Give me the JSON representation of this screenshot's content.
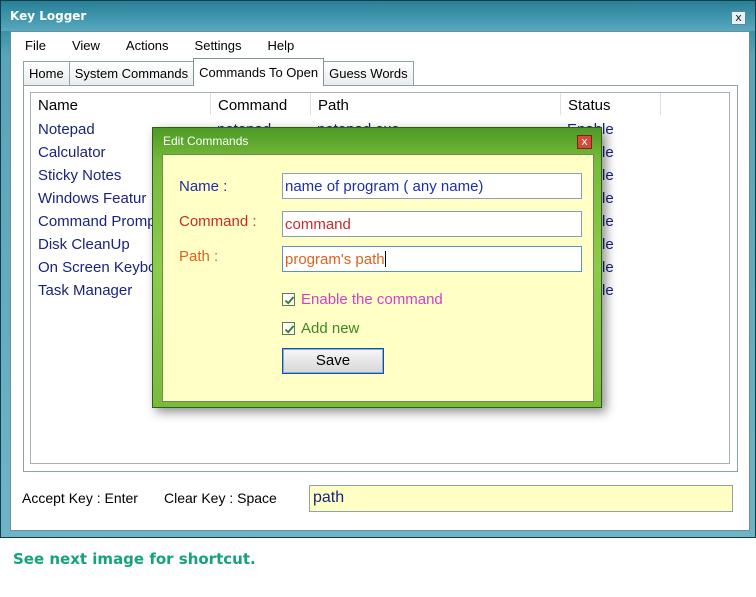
{
  "window": {
    "title": "Key Logger",
    "close_glyph": "x"
  },
  "menu": [
    {
      "label": "File"
    },
    {
      "label": "View"
    },
    {
      "label": "Actions"
    },
    {
      "label": "Settings"
    },
    {
      "label": "Help"
    }
  ],
  "tabs": [
    {
      "label": "Home",
      "active": false
    },
    {
      "label": "System Commands",
      "active": false
    },
    {
      "label": "Commands To Open",
      "active": true
    },
    {
      "label": "Guess Words",
      "active": false
    }
  ],
  "list": {
    "columns": [
      "Name",
      "Command",
      "Path",
      "Status"
    ],
    "rows": [
      {
        "name": "Notepad",
        "command": "notepad",
        "path": "notepad.exe",
        "status": "Enable"
      },
      {
        "name": "Calculator",
        "status": "Enable"
      },
      {
        "name": "Sticky Notes",
        "status": "Enable"
      },
      {
        "name": "Windows Featur",
        "status": "Enable"
      },
      {
        "name": "Command Promp",
        "status": "Enable"
      },
      {
        "name": "Disk CleanUp",
        "status": "Enable"
      },
      {
        "name": "On Screen Keybo",
        "status": "Enable"
      },
      {
        "name": "Task Manager",
        "status": "Enable"
      }
    ]
  },
  "bottom": {
    "accept_key": "Accept Key : Enter",
    "clear_key": "Clear Key : Space",
    "input_value": "path"
  },
  "dialog": {
    "title": "Edit Commands",
    "close_glyph": "x",
    "name_label": "Name :",
    "name_value": "name of program ( any name)",
    "command_label": "Command :",
    "command_value": "command",
    "path_label": "Path :",
    "path_value": "program's path",
    "enable_label": "Enable the command",
    "enable_checked": true,
    "addnew_label": "Add new",
    "addnew_checked": true,
    "save_label": "Save"
  },
  "colors": {
    "name_label": "#1f2fa8",
    "command_label": "#c72b2b",
    "path_label": "#e0621d",
    "enable_label": "#d43fc8",
    "addnew_label": "#3a8a1f",
    "caption": "#14a37c"
  },
  "caption": "See next image for shortcut."
}
